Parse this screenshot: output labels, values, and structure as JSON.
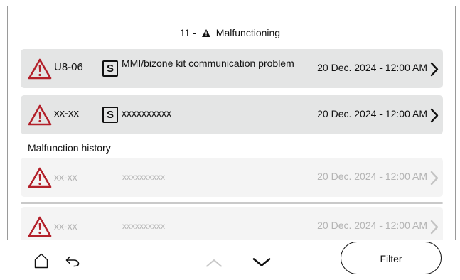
{
  "header": {
    "count": "11 -",
    "title": "Malfunctioning"
  },
  "active_malfunctions": [
    {
      "code": "U8-06",
      "source_badge": "S",
      "description": "MMI/bizone kit communication problem",
      "date": "20 Dec. 2024 - 12:00 AM"
    },
    {
      "code": "xx-xx",
      "source_badge": "S",
      "description": "xxxxxxxxxx",
      "date": "20 Dec. 2024 - 12:00 AM"
    }
  ],
  "history": {
    "title": "Malfunction history",
    "items": [
      {
        "code": "xx-xx",
        "description": "xxxxxxxxxx",
        "date": "20 Dec. 2024 - 12:00 AM"
      },
      {
        "code": "xx-xx",
        "description": "xxxxxxxxxx",
        "date": "20 Dec. 2024 - 12:00 AM"
      }
    ]
  },
  "footer": {
    "filter_label": "Filter"
  },
  "colors": {
    "warning_red": "#b3202a",
    "card_bg": "#e4e5e5",
    "history_card_bg": "#f4f4f4",
    "muted_text": "#b4b4b4"
  },
  "icons": [
    "warning-triangle-icon",
    "home-icon",
    "back-arrow-icon",
    "chevron-up-icon",
    "chevron-down-icon",
    "chevron-right-icon"
  ]
}
